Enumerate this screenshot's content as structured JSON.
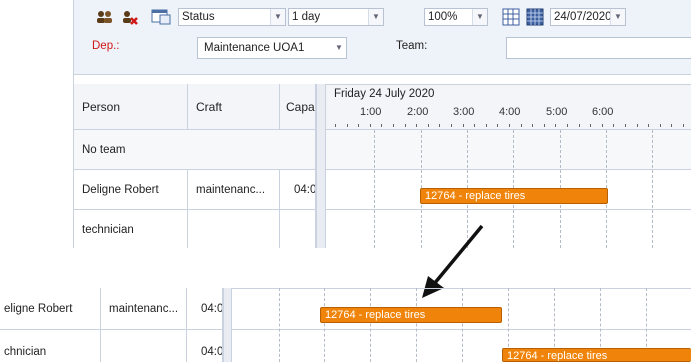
{
  "toolbar": {
    "status_value": "Status",
    "duration_value": "1 day",
    "zoom_value": "100%",
    "date_value": "24/07/2020",
    "dep_label": "Dep.:",
    "dep_value": "Maintenance UOA1",
    "team_label": "Team:",
    "team_value": ""
  },
  "columns": {
    "person": "Person",
    "craft": "Craft",
    "capacity": "Capa"
  },
  "timeline": {
    "date_heading": "Friday 24 July 2020",
    "ticks": [
      "1:00",
      "2:00",
      "3:00",
      "4:00",
      "5:00",
      "6:00"
    ]
  },
  "rows": [
    {
      "person": "No team",
      "craft": "",
      "capacity": ""
    },
    {
      "person": "Deligne Robert",
      "craft": "maintenanc...",
      "capacity": "04:0"
    },
    {
      "person": "technician",
      "craft": "",
      "capacity": ""
    }
  ],
  "zoom_rows": [
    {
      "person": "eligne Robert",
      "craft": "maintenanc...",
      "capacity": "04:0"
    },
    {
      "person": "chnician",
      "craft": "",
      "capacity": "04:0"
    }
  ],
  "task_label": "12764 - replace tires",
  "colors": {
    "task_bar": "#f0840a",
    "dep_label": "#d01818",
    "arrow": "#111111"
  }
}
